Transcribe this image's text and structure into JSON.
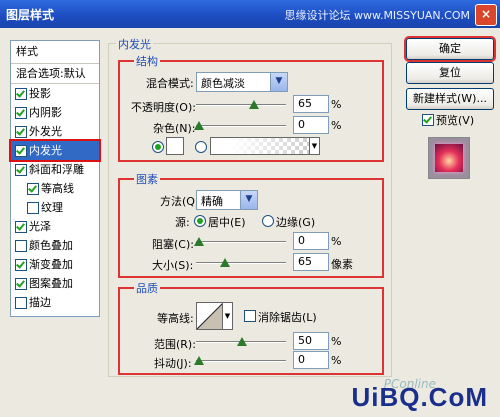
{
  "window": {
    "title": "图层样式",
    "watermark": "思缘设计论坛 www.MISSYUAN.COM",
    "close": "×"
  },
  "styles": {
    "header": "样式",
    "blending": "混合选项:默认",
    "items": [
      {
        "label": "投影",
        "checked": true,
        "indent": false
      },
      {
        "label": "内阴影",
        "checked": true,
        "indent": false
      },
      {
        "label": "外发光",
        "checked": true,
        "indent": false
      },
      {
        "label": "内发光",
        "checked": true,
        "indent": false,
        "selected": true
      },
      {
        "label": "斜面和浮雕",
        "checked": true,
        "indent": false
      },
      {
        "label": "等高线",
        "checked": true,
        "indent": true
      },
      {
        "label": "纹理",
        "checked": false,
        "indent": true
      },
      {
        "label": "光泽",
        "checked": true,
        "indent": false
      },
      {
        "label": "颜色叠加",
        "checked": false,
        "indent": false
      },
      {
        "label": "渐变叠加",
        "checked": true,
        "indent": false
      },
      {
        "label": "图案叠加",
        "checked": true,
        "indent": false
      },
      {
        "label": "描边",
        "checked": false,
        "indent": false
      }
    ]
  },
  "inner_glow": {
    "title": "内发光",
    "structure": {
      "title": "结构",
      "blend_mode_label": "混合模式:",
      "blend_mode": "颜色减淡",
      "opacity_label": "不透明度(O):",
      "opacity": "65",
      "opacity_unit": "%",
      "noise_label": "杂色(N):",
      "noise": "0",
      "noise_unit": "%"
    },
    "elements": {
      "title": "图素",
      "technique_label": "方法(Q):",
      "technique": "精确",
      "source_label": "源:",
      "center": "居中(E)",
      "edge": "边缘(G)",
      "choke_label": "阻塞(C):",
      "choke": "0",
      "choke_unit": "%",
      "size_label": "大小(S):",
      "size": "65",
      "size_unit": "像素"
    },
    "quality": {
      "title": "品质",
      "contour_label": "等高线:",
      "antialias_label": "消除锯齿(L)",
      "range_label": "范围(R):",
      "range": "50",
      "range_unit": "%",
      "jitter_label": "抖动(J):",
      "jitter": "0",
      "jitter_unit": "%"
    }
  },
  "buttons": {
    "ok": "确定",
    "reset": "复位",
    "new_style": "新建样式(W)...",
    "preview": "预览(V)"
  },
  "branding": {
    "pconline": "PConline",
    "uibq": "UiBQ.CoM"
  }
}
